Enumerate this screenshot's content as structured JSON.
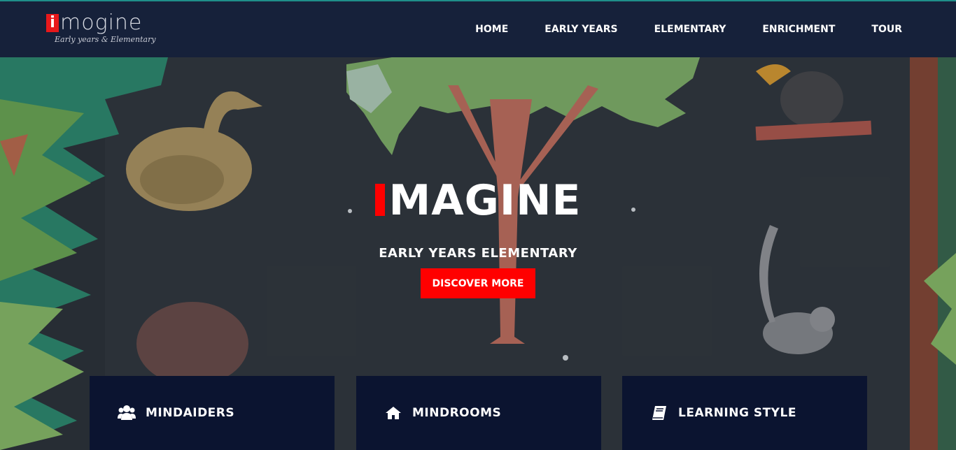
{
  "brand": {
    "logo_letter": "i",
    "logo_word": "mogine",
    "logo_tagline": "Early years & Elementary",
    "accent_color": "#ff0000",
    "nav_bg": "#16213a"
  },
  "nav": {
    "items": [
      {
        "label": "HOME"
      },
      {
        "label": "EARLY YEARS"
      },
      {
        "label": "ELEMENTARY"
      },
      {
        "label": "ENRICHMENT"
      },
      {
        "label": "TOUR"
      }
    ]
  },
  "hero": {
    "title": "MAGINE",
    "subtitle": "EARLY YEARS ELEMENTARY",
    "cta_label": "DISCOVER MORE"
  },
  "features": [
    {
      "label": "MINDAIDERS",
      "icon": "users-icon"
    },
    {
      "label": "MINDROOMS",
      "icon": "home-icon"
    },
    {
      "label": "LEARNING STYLE",
      "icon": "book-icon"
    }
  ]
}
